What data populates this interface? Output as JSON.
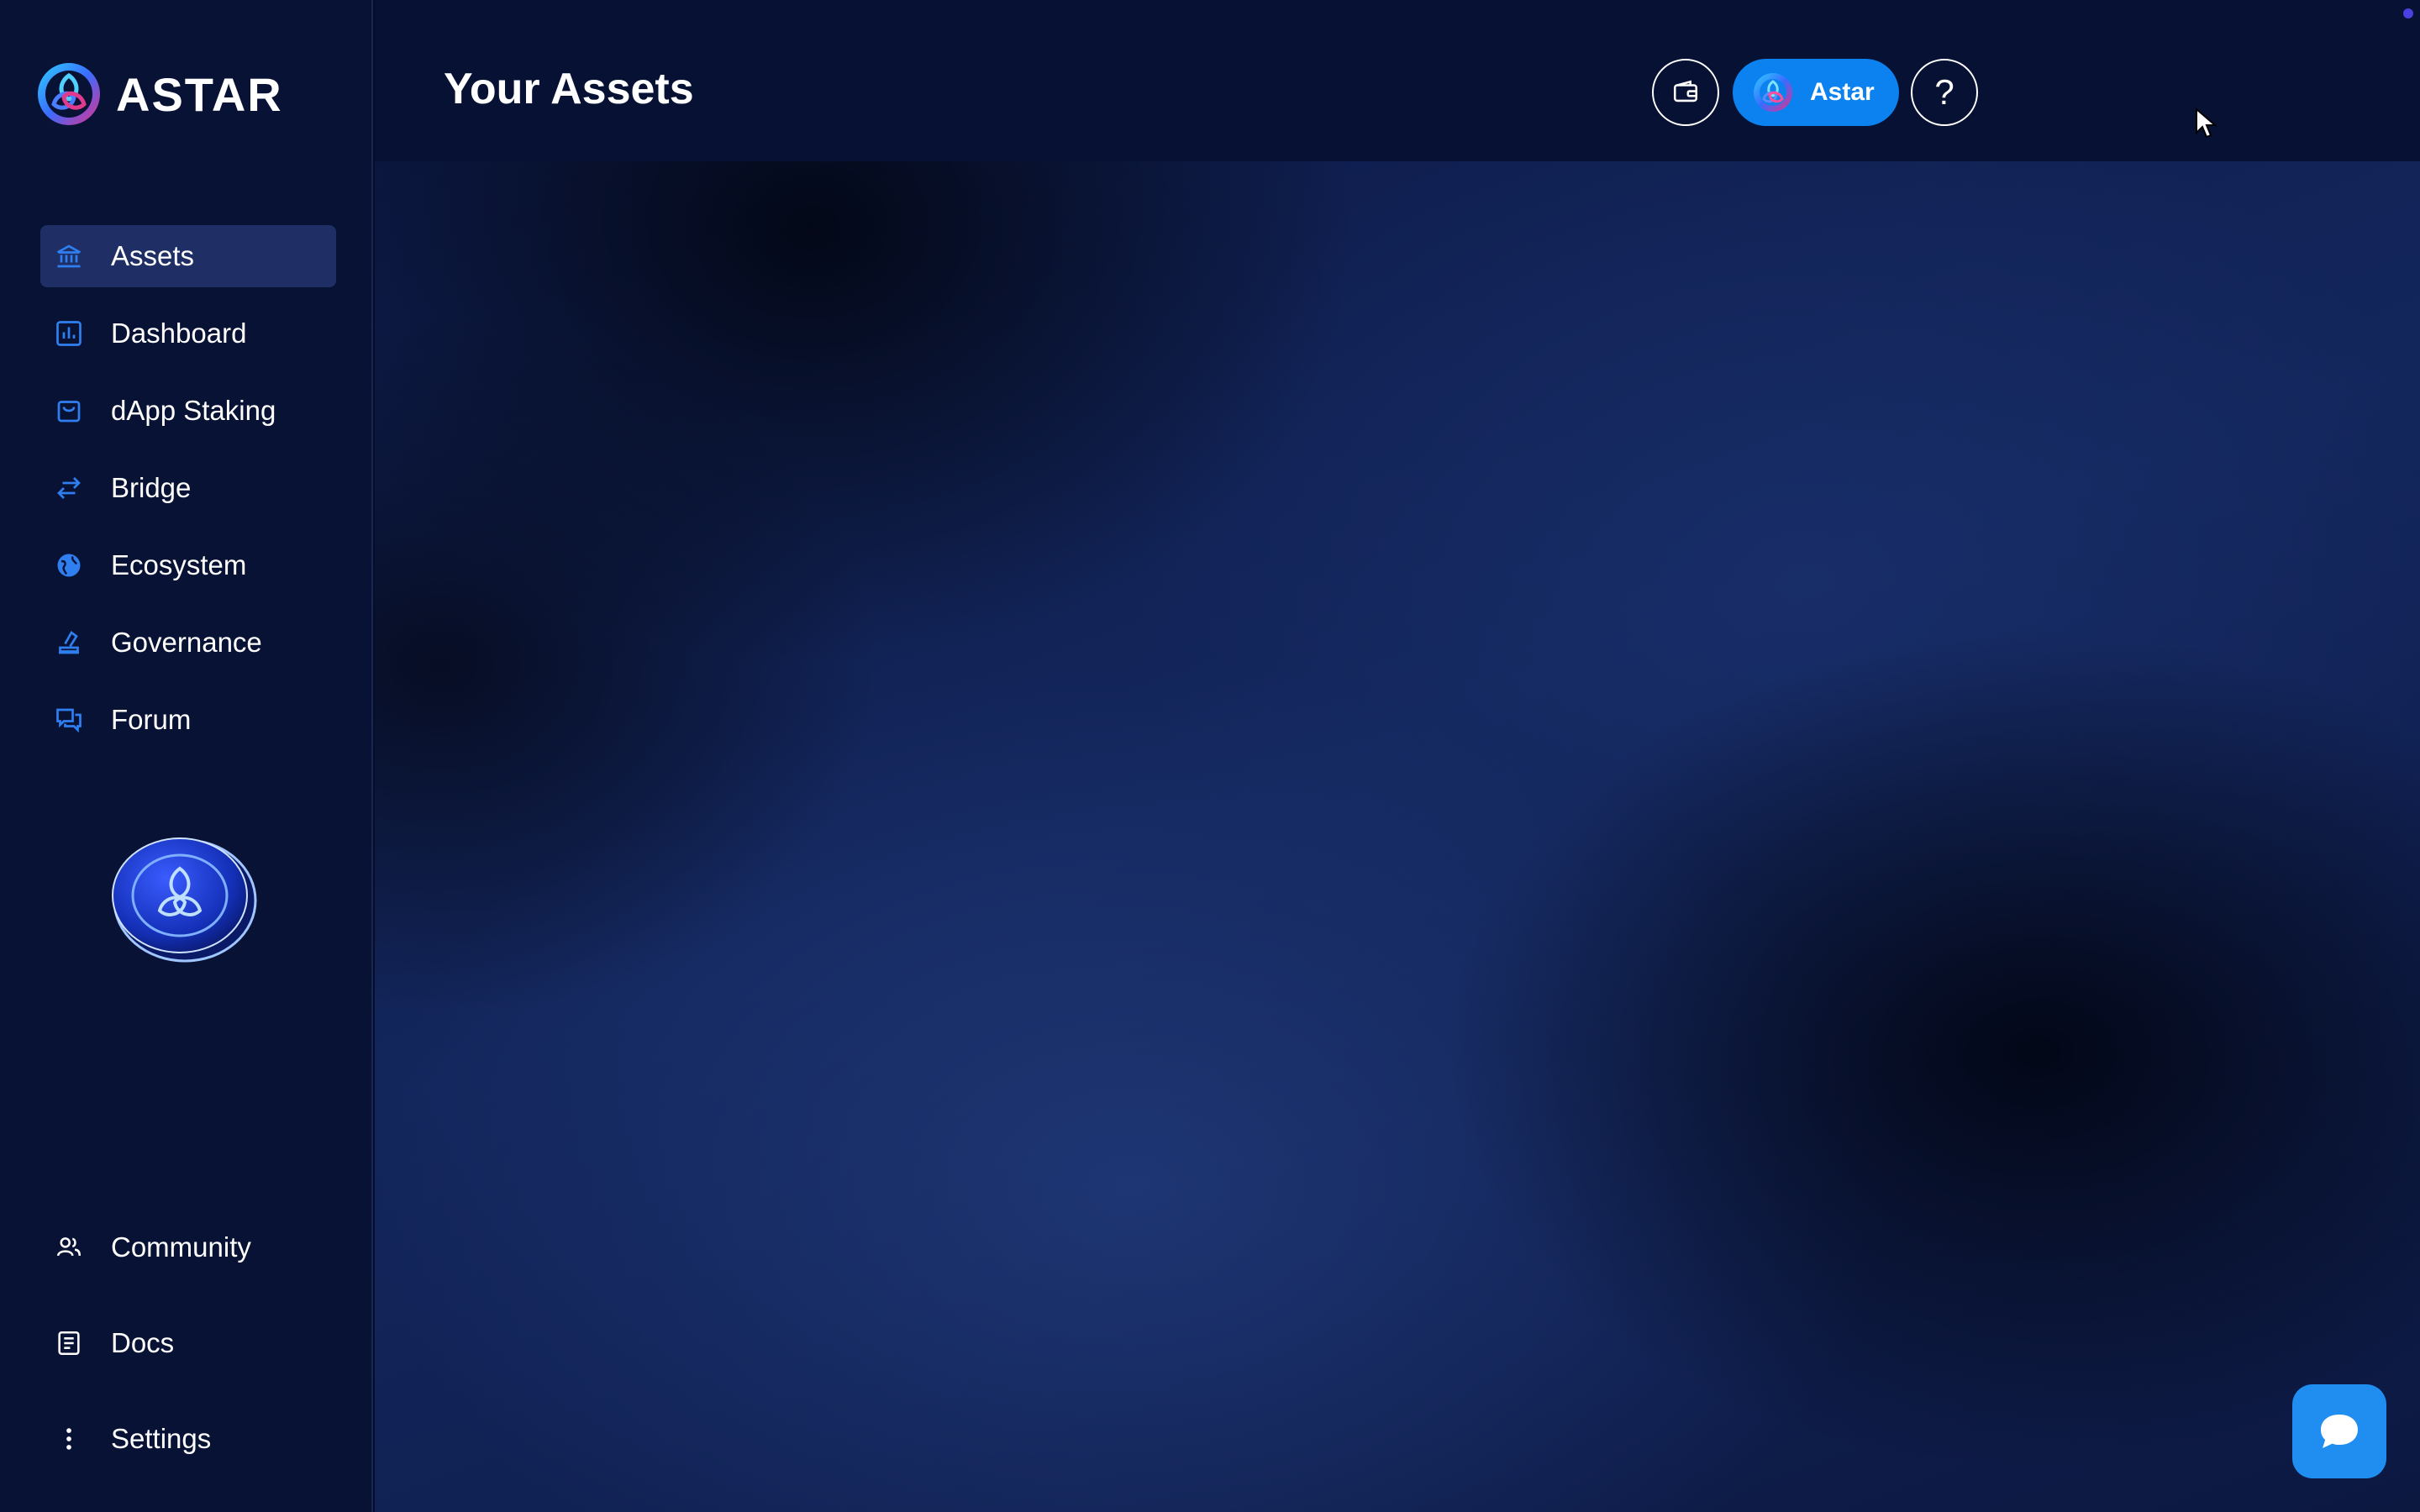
{
  "brand": {
    "name": "ASTAR"
  },
  "sidebar": {
    "items": [
      {
        "label": "Assets",
        "icon": "bank-icon",
        "active": true
      },
      {
        "label": "Dashboard",
        "icon": "chart-icon"
      },
      {
        "label": "dApp Staking",
        "icon": "bag-icon"
      },
      {
        "label": "Bridge",
        "icon": "arrows-icon"
      },
      {
        "label": "Ecosystem",
        "icon": "globe-icon"
      },
      {
        "label": "Governance",
        "icon": "vote-icon"
      },
      {
        "label": "Forum",
        "icon": "chat-bubbles-icon"
      }
    ],
    "bottom_items": [
      {
        "label": "Community",
        "icon": "people-icon"
      },
      {
        "label": "Docs",
        "icon": "document-icon"
      },
      {
        "label": "Settings",
        "icon": "vertical-dots-icon"
      }
    ]
  },
  "header": {
    "title": "Your Assets",
    "network_label": "Astar",
    "help_label": "?"
  },
  "colors": {
    "accent": "#0b82f0",
    "icon_blue": "#2f7ff0",
    "active_bg": "#1f2f66",
    "sidebar_bg": "#081235"
  }
}
